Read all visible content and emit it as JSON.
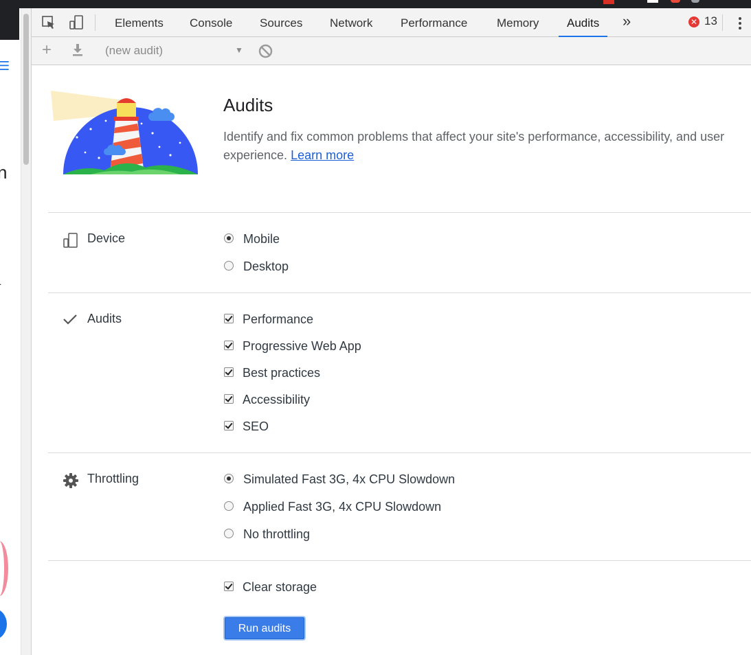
{
  "devtools": {
    "tabs": [
      {
        "label": "Elements"
      },
      {
        "label": "Console"
      },
      {
        "label": "Sources"
      },
      {
        "label": "Network"
      },
      {
        "label": "Performance"
      },
      {
        "label": "Memory"
      },
      {
        "label": "Audits",
        "active": true
      }
    ],
    "more_tabs_glyph": "»",
    "error_count": "13",
    "error_badge_glyph": "✕"
  },
  "toolbar": {
    "new_audit_glyph": "+",
    "audit_select_value": "(new audit)",
    "dropdown_glyph": "▼"
  },
  "header": {
    "title": "Audits",
    "description": "Identify and fix common problems that affect your site's performance, accessibility, and user experience.",
    "learn_more": "Learn more"
  },
  "device": {
    "label": "Device",
    "options": [
      {
        "label": "Mobile",
        "selected": true
      },
      {
        "label": "Desktop",
        "selected": false
      }
    ]
  },
  "audits": {
    "label": "Audits",
    "options": [
      {
        "label": "Performance",
        "checked": true
      },
      {
        "label": "Progressive Web App",
        "checked": true
      },
      {
        "label": "Best practices",
        "checked": true
      },
      {
        "label": "Accessibility",
        "checked": true
      },
      {
        "label": "SEO",
        "checked": true
      }
    ]
  },
  "throttling": {
    "label": "Throttling",
    "options": [
      {
        "label": "Simulated Fast 3G, 4x CPU Slowdown",
        "selected": true
      },
      {
        "label": "Applied Fast 3G, 4x CPU Slowdown",
        "selected": false
      },
      {
        "label": "No throttling",
        "selected": false
      }
    ]
  },
  "storage": {
    "label": "Clear storage",
    "checked": true
  },
  "run_button": "Run audits",
  "colors": {
    "accent": "#1a73e8",
    "button": "#3b7de8",
    "link": "#1a5fd7"
  }
}
